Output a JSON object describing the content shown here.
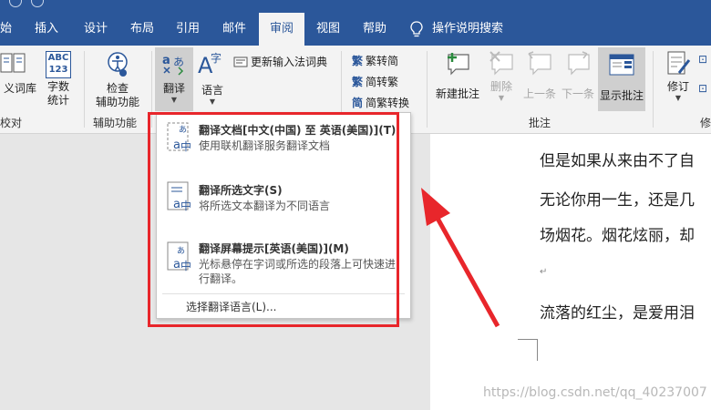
{
  "tabs": [
    {
      "label": "始",
      "active": false
    },
    {
      "label": "插入",
      "active": false
    },
    {
      "label": "设计",
      "active": false
    },
    {
      "label": "布局",
      "active": false
    },
    {
      "label": "引用",
      "active": false
    },
    {
      "label": "邮件",
      "active": false
    },
    {
      "label": "审阅",
      "active": true
    },
    {
      "label": "视图",
      "active": false
    },
    {
      "label": "帮助",
      "active": false
    }
  ],
  "tell_me": {
    "label": "操作说明搜索",
    "icon": "lightbulb-icon"
  },
  "ribbon": {
    "proofing": {
      "thesaurus_label": "义词库",
      "wordcount_label": "字数\n统计",
      "wordcount_icon_text": "ABC\n123",
      "group_label": "校对"
    },
    "accessibility": {
      "check_label": "检查\n辅助功能",
      "group_label": "辅助功能"
    },
    "language": {
      "translate_label": "翻译",
      "language_label": "语言",
      "update_ime_label": "更新输入法词典"
    },
    "chinese": {
      "to_simplified": "繁转简",
      "to_traditional": "简转繁",
      "convert": "简繁转换"
    },
    "comments": {
      "new_label": "新建批注",
      "delete_label": "删除",
      "prev_label": "上一条",
      "next_label": "下一条",
      "show_label": "显示批注",
      "group_label": "批注"
    },
    "tracking": {
      "track_label": "修订",
      "group_label": "修"
    }
  },
  "dropdown": {
    "items": [
      {
        "title": "翻译文档[中文(中国) 至 英语(美国)](T)",
        "desc": "使用联机翻译服务翻译文档"
      },
      {
        "title": "翻译所选文字(S)",
        "desc": "将所选文本翻译为不同语言"
      },
      {
        "title": "翻译屏幕提示[英语(美国)](M)",
        "desc": "光标悬停在字词或所选的段落上可快速进行翻译。"
      }
    ],
    "footer": "选择翻译语言(L)..."
  },
  "document": {
    "lines": [
      "但是如果从来由不了自",
      "无论你用一生，还是几",
      "场烟花。烟花炫丽，却",
      "流落的红尘，是爱用泪"
    ],
    "para_mark": "↵"
  },
  "watermark": "https://blog.csdn.net/qq_40237007",
  "colors": {
    "accent": "#2b579a",
    "highlight": "#e8262b"
  }
}
